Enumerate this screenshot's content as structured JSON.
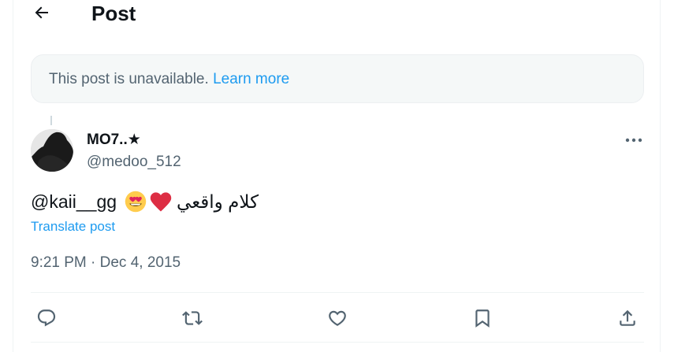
{
  "header": {
    "title": "Post",
    "back_icon": "arrow-left-icon"
  },
  "notice": {
    "text": "This post is unavailable.",
    "link": "Learn more"
  },
  "post": {
    "display_name": "MO7..★",
    "handle": "@medoo_512",
    "mention": "@kaii__gg",
    "emojis": [
      "heart-eyes-emoji",
      "red-heart-emoji"
    ],
    "arabic_text": "كلام واقعي",
    "translate_label": "Translate post",
    "timestamp": "9:21 PM · Dec 4, 2015"
  },
  "actions": {
    "reply_icon": "reply-icon",
    "repost_icon": "repost-icon",
    "like_icon": "like-icon",
    "bookmark_icon": "bookmark-icon",
    "share_icon": "share-icon"
  },
  "colors": {
    "accent": "#1d9bf0",
    "secondary_text": "#536471",
    "notice_bg": "#f5f8f8",
    "emoji_heart": "#e0245e"
  }
}
